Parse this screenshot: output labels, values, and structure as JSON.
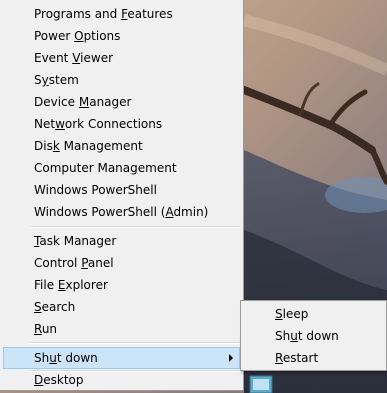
{
  "menu": {
    "items": [
      {
        "label": "Programs and Features",
        "pre": "Programs and ",
        "ul": "F",
        "post": "eatures"
      },
      {
        "label": "Power Options",
        "pre": "Power ",
        "ul": "O",
        "post": "ptions"
      },
      {
        "label": "Event Viewer",
        "pre": "Event ",
        "ul": "V",
        "post": "iewer"
      },
      {
        "label": "System",
        "pre": "S",
        "ul": "y",
        "post": "stem"
      },
      {
        "label": "Device Manager",
        "pre": "Device ",
        "ul": "M",
        "post": "anager"
      },
      {
        "label": "Network Connections",
        "pre": "Net",
        "ul": "w",
        "post": "ork Connections"
      },
      {
        "label": "Disk Management",
        "pre": "Dis",
        "ul": "k",
        "post": " Management"
      },
      {
        "label": "Computer Management",
        "pre": "Computer Mana",
        "ul": "g",
        "post": "ement"
      },
      {
        "label": "Windows PowerShell",
        "pre": "W",
        "ul": "",
        "post": "indows PowerShell"
      },
      {
        "label": "Windows PowerShell (Admin)",
        "pre": "Windows PowerShell (",
        "ul": "A",
        "post": "dmin)"
      },
      {
        "label": "Task Manager",
        "pre": "",
        "ul": "T",
        "post": "ask Manager"
      },
      {
        "label": "Control Panel",
        "pre": "Control ",
        "ul": "P",
        "post": "anel"
      },
      {
        "label": "File Explorer",
        "pre": "File ",
        "ul": "E",
        "post": "xplorer"
      },
      {
        "label": "Search",
        "pre": "",
        "ul": "S",
        "post": "earch"
      },
      {
        "label": "Run",
        "pre": "",
        "ul": "R",
        "post": "un"
      },
      {
        "label": "Shut down",
        "pre": "Sh",
        "ul": "u",
        "post": "t down",
        "highlighted": true,
        "has_submenu": true
      },
      {
        "label": "Desktop",
        "pre": "",
        "ul": "D",
        "post": "esktop"
      }
    ]
  },
  "submenu": {
    "items": [
      {
        "label": "Sleep",
        "pre": "",
        "ul": "S",
        "post": "leep"
      },
      {
        "label": "Shut down",
        "pre": "Sh",
        "ul": "u",
        "post": "t down"
      },
      {
        "label": "Restart",
        "pre": "",
        "ul": "R",
        "post": "estart"
      }
    ]
  },
  "colors": {
    "menu_bg": "#f0f0f0",
    "highlight_bg": "#cce4f7",
    "highlight_border": "#99c9ef",
    "border": "#9a9a9a"
  }
}
